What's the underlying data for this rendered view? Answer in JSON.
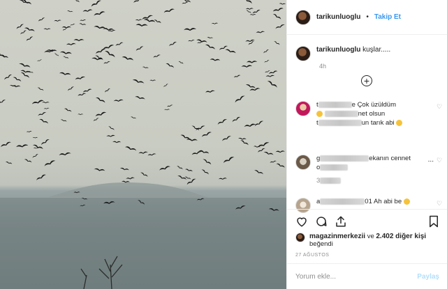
{
  "post": {
    "username": "tarikunluoglu",
    "follow_label": "Takip Et",
    "separator": "•",
    "caption": "kuşlar.....",
    "caption_time": "4h"
  },
  "comments": [
    {
      "line1_prefix": "t",
      "line1_suffix": "e Çok üzüldüm",
      "line2_suffix": "net olsun",
      "line3_prefix": "t",
      "line3_suffix": "un tarık abi"
    },
    {
      "line1_prefix": "g",
      "line1_suffix": "ekanın cennet",
      "line2_prefix": "o",
      "line3": "3"
    },
    {
      "line1_prefix": "a",
      "line1_suffix": "01 Ah abi be"
    }
  ],
  "more_label": "...",
  "likes": {
    "first_user": "magazinmerkezii",
    "connector": "ve",
    "others_count": "2.402 diğer kişi",
    "suffix": "beğendi"
  },
  "date": "27 AĞUSTOS",
  "comment_input": {
    "placeholder": "Yorum ekle...",
    "post_label": "Paylaş"
  },
  "icons": {
    "heart": "heart-icon",
    "comment": "comment-icon",
    "share": "share-icon",
    "bookmark": "bookmark-icon",
    "add": "plus-circle-icon"
  }
}
